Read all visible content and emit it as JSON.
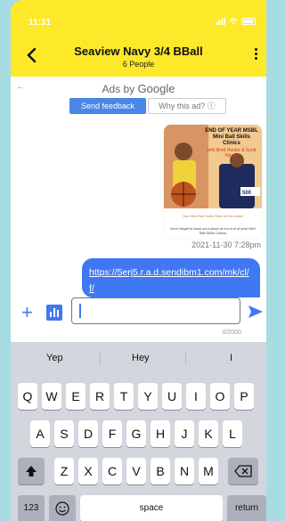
{
  "status": {
    "time": "11:31"
  },
  "header": {
    "title": "Seaview Navy 3/4 BBall",
    "subtitle": "6 People"
  },
  "ad": {
    "ads_by": "Ads by",
    "brand": "Google",
    "feedback_label": "Send feedback",
    "why_label": "Why this ad? ⓘ"
  },
  "messages": {
    "image_title": "END OF YEAR MSBL Mini Ball Skills Clinics",
    "image_subtitle": "with Brett Hunter & Scott Nicolo",
    "image_caption": "Your Mini Ball Skills Clinic is this week!",
    "image_caption2": "Don't forget to book your place at our end of year Mini Ball Skills Clinics",
    "timestamp": "2021-11-30 7:28pm",
    "link": "https://5erj5.r.a.d.sendibm1.com/mk/cl/f/"
  },
  "composer": {
    "placeholder": "",
    "counter": "0/2000"
  },
  "keyboard": {
    "suggestions": [
      "Yep",
      "Hey",
      "I"
    ],
    "row1": [
      "Q",
      "W",
      "E",
      "R",
      "T",
      "Y",
      "U",
      "I",
      "O",
      "P"
    ],
    "row2": [
      "A",
      "S",
      "D",
      "F",
      "G",
      "H",
      "J",
      "K",
      "L"
    ],
    "row3": [
      "Z",
      "X",
      "C",
      "V",
      "B",
      "N",
      "M"
    ],
    "numbers_label": "123",
    "space_label": "space",
    "return_label": "return"
  },
  "colors": {
    "header": "#fde92a",
    "accent": "#3f78f2",
    "background": "#a6dce2"
  }
}
